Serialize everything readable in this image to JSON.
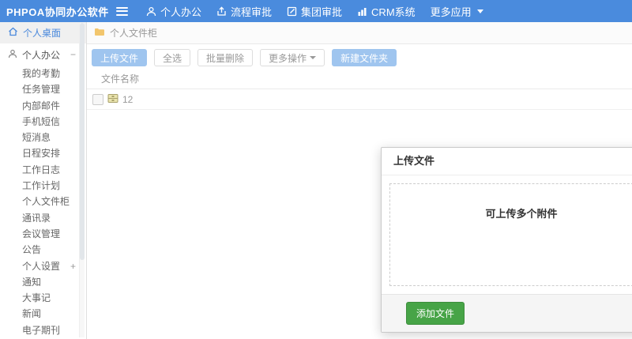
{
  "topbar": {
    "brand": "PHPOA协同办公软件",
    "nav": [
      {
        "label": "个人办公",
        "icon": "user-icon"
      },
      {
        "label": "流程审批",
        "icon": "flow-approval-icon"
      },
      {
        "label": "集团审批",
        "icon": "edit-icon"
      },
      {
        "label": "CRM系统",
        "icon": "bar-chart-icon"
      },
      {
        "label": "更多应用",
        "icon": "caret-down-icon"
      }
    ]
  },
  "sidebar": {
    "desktop_item": {
      "label": "个人桌面",
      "icon": "home-icon"
    },
    "group_item": {
      "label": "个人办公",
      "icon": "person-icon",
      "toggle": "−"
    },
    "items": [
      {
        "label": "我的考勤"
      },
      {
        "label": "任务管理"
      },
      {
        "label": "内部邮件"
      },
      {
        "label": "手机短信"
      },
      {
        "label": "短消息"
      },
      {
        "label": "日程安排"
      },
      {
        "label": "工作日志"
      },
      {
        "label": "工作计划"
      },
      {
        "label": "个人文件柜"
      },
      {
        "label": "通讯录"
      },
      {
        "label": "会议管理"
      },
      {
        "label": "公告"
      },
      {
        "label": "个人设置",
        "toggle": "+"
      },
      {
        "label": "通知"
      },
      {
        "label": "大事记"
      },
      {
        "label": "新闻"
      },
      {
        "label": "电子期刊"
      }
    ]
  },
  "main": {
    "breadcrumb": {
      "label": "个人文件柜",
      "icon": "folder-icon"
    },
    "toolbar": {
      "upload_label": "上传文件",
      "select_all_label": "全选",
      "batch_delete_label": "批量删除",
      "more_actions_label": "更多操作",
      "new_folder_label": "新建文件夹"
    },
    "table": {
      "name_header": "文件名称",
      "rows": [
        {
          "name": "12",
          "icon": "cabinet-icon"
        }
      ]
    }
  },
  "dialog": {
    "title": "上传文件",
    "dropzone_hint": "可上传多个附件",
    "add_file_label": "添加文件"
  },
  "colors": {
    "topbar_blue": "#4a8bdd",
    "accent_blue": "#4a89dc",
    "light_blue_button": "#9fc5ef",
    "green_button": "#47a447",
    "folder_yellow": "#f2c66d"
  }
}
